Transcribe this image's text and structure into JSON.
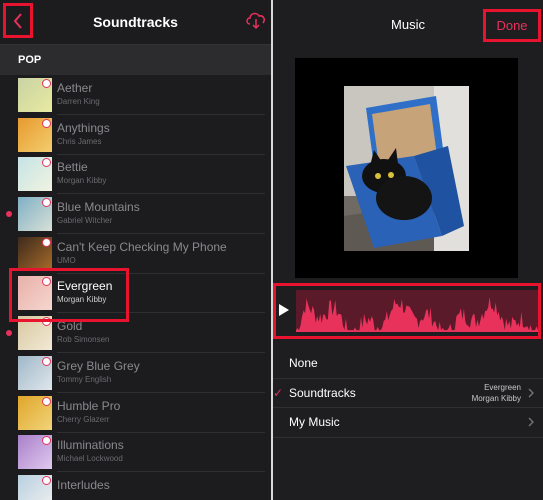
{
  "left": {
    "title": "Soundtracks",
    "section": "POP",
    "tracks": [
      {
        "name": "Aether",
        "artist": "Darren King",
        "dot": false,
        "selected": false,
        "c1": "#c9d3a4",
        "c2": "#e8eaa0"
      },
      {
        "name": "Anythings",
        "artist": "Chris James",
        "dot": false,
        "selected": false,
        "c1": "#e79a2e",
        "c2": "#f3cd6e"
      },
      {
        "name": "Bettie",
        "artist": "Morgan Kibby",
        "dot": false,
        "selected": false,
        "c1": "#c5e3e6",
        "c2": "#f1f3e0"
      },
      {
        "name": "Blue Mountains",
        "artist": "Gabriel Witcher",
        "dot": true,
        "selected": false,
        "c1": "#7fb0c6",
        "c2": "#d8e0d6"
      },
      {
        "name": "Can't Keep Checking My Phone",
        "artist": "UMO",
        "dot": false,
        "selected": false,
        "c1": "#3d2a1c",
        "c2": "#a86b2a"
      },
      {
        "name": "Evergreen",
        "artist": "Morgan Kibby",
        "dot": false,
        "selected": true,
        "c1": "#e8b0a8",
        "c2": "#f5d6cf"
      },
      {
        "name": "Gold",
        "artist": "Rob Simonsen",
        "dot": true,
        "selected": false,
        "c1": "#d8c7a0",
        "c2": "#f2ead6"
      },
      {
        "name": "Grey Blue Grey",
        "artist": "Tommy English",
        "dot": false,
        "selected": false,
        "c1": "#9fb8c8",
        "c2": "#dfe6ec"
      },
      {
        "name": "Humble Pro",
        "artist": "Cherry Glazerr",
        "dot": false,
        "selected": false,
        "c1": "#e0a62a",
        "c2": "#f1d47a"
      },
      {
        "name": "Illuminations",
        "artist": "Michael Lockwood",
        "dot": false,
        "selected": false,
        "c1": "#a880c8",
        "c2": "#e0c8f0"
      },
      {
        "name": "Interludes",
        "artist": "",
        "dot": false,
        "selected": false,
        "c1": "#b8d0e0",
        "c2": "#f0f0f0"
      }
    ]
  },
  "right": {
    "title": "Music",
    "done_label": "Done",
    "options": [
      {
        "label": "None",
        "checked": false,
        "value_line1": "",
        "value_line2": "",
        "chevron": false
      },
      {
        "label": "Soundtracks",
        "checked": true,
        "value_line1": "Evergreen",
        "value_line2": "Morgan Kibby",
        "chevron": true
      },
      {
        "label": "My Music",
        "checked": false,
        "value_line1": "",
        "value_line2": "",
        "chevron": true
      }
    ]
  },
  "colors": {
    "accent": "#e8315b",
    "highlight_box": "#e8132e",
    "waveform": "#e8315b"
  },
  "icons": {
    "back": "chevron-left-icon",
    "cloud": "cloud-download-icon",
    "play": "play-icon",
    "check": "checkmark-icon"
  }
}
